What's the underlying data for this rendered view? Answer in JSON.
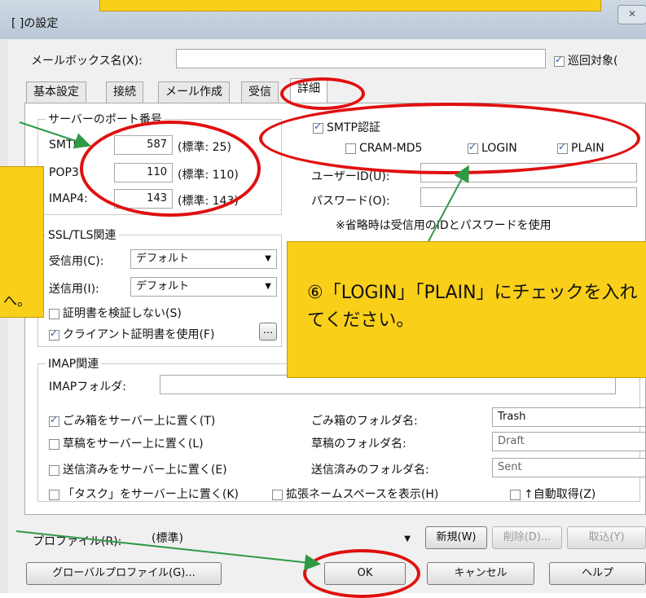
{
  "window": {
    "title": "[ ]の設定",
    "close_glyph": "✕"
  },
  "mailbox": {
    "label": "メールボックス名(X):",
    "value": "",
    "cycle_label": "巡回対象("
  },
  "tabs": [
    {
      "label": "基本設定"
    },
    {
      "label": "接続"
    },
    {
      "label": "メール作成"
    },
    {
      "label": "受信"
    },
    {
      "label": "詳細",
      "active": true
    }
  ],
  "server_ports": {
    "legend": "サーバーのポート番号",
    "smtp": {
      "label": "SMTP",
      "value": "587",
      "std": "(標準: 25)"
    },
    "pop3": {
      "label": "POP3",
      "value": "110",
      "std": "(標準: 110)"
    },
    "imap4": {
      "label": "IMAP4:",
      "value": "143",
      "std": "(標準: 143)"
    }
  },
  "smtp_auth": {
    "label": "SMTP認証",
    "checked": true,
    "cram_md5": {
      "label": "CRAM-MD5",
      "checked": false
    },
    "login": {
      "label": "LOGIN",
      "checked": true
    },
    "plain": {
      "label": "PLAIN",
      "checked": true
    },
    "user_label": "ユーザーID(U):",
    "pass_label": "パスワード(O):",
    "note": "※省略時は受信用のIDとパスワードを使用"
  },
  "ssl": {
    "legend": "SSL/TLS関連",
    "recv_label": "受信用(C):",
    "recv_value": "デフォルト",
    "send_label": "送信用(I):",
    "send_value": "デフォルト",
    "no_verify_label": "証明書を検証しない(S)",
    "client_cert_label": "クライアント証明書を使用(F)",
    "browse_label": "..."
  },
  "imap": {
    "legend": "IMAP関連",
    "folder_label": "IMAPフォルダ:",
    "trash_server": "ごみ箱をサーバー上に置く(T)",
    "draft_server": "草稿をサーバー上に置く(L)",
    "sent_server": "送信済みをサーバー上に置く(E)",
    "task_server": "「タスク」をサーバー上に置く(K)",
    "ext_namespace": "拡張ネームスペースを表示(H)",
    "auto_fetch": "↑自動取得(Z)",
    "trash_folder_label": "ごみ箱のフォルダ名:",
    "trash_folder": "Trash",
    "draft_folder_label": "草稿のフォルダ名:",
    "draft_folder": "Draft",
    "sent_folder_label": "送信済みのフォルダ名:",
    "sent_folder": "Sent"
  },
  "profile": {
    "label": "プロファイル(R):",
    "value": "(標準)",
    "new": "新規(W)",
    "delete": "削除(D)...",
    "import": "取込(Y)"
  },
  "buttons": {
    "global": "グローバルプロファイル(G)...",
    "ok": "OK",
    "cancel": "キャンセル",
    "help": "ヘルプ"
  },
  "callouts": {
    "left_fragment": "へ。",
    "main": "⑥「LOGIN」「PLAIN」にチェックを入れてください。"
  },
  "colors": {
    "callout": "#f9cf1a",
    "ring": "#e01010",
    "arrow": "#2f9a46"
  }
}
